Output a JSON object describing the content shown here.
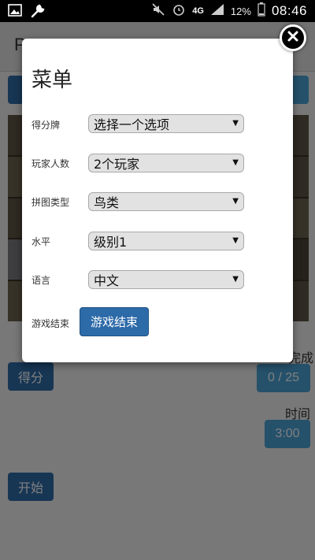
{
  "status_bar": {
    "network": "4G",
    "battery_percent": "12%",
    "time": "08:46"
  },
  "app": {
    "title": "P",
    "score_button": "得分",
    "completed_label": "完成",
    "progress": "0 / 25",
    "time_label": "时间",
    "timer": "3:00",
    "start_button": "开始"
  },
  "menu": {
    "title": "菜单",
    "rows": [
      {
        "label": "得分牌",
        "value": "选择一个选项"
      },
      {
        "label": "玩家人数",
        "value": "2个玩家"
      },
      {
        "label": "拼图类型",
        "value": "鸟类"
      },
      {
        "label": "水平",
        "value": "级别1"
      },
      {
        "label": "语言",
        "value": "中文"
      }
    ],
    "end_game_label": "游戏结束",
    "end_game_button": "游戏结束"
  },
  "icons": {
    "close": "close-icon",
    "image": "image-icon",
    "wrench": "wrench-icon",
    "mute": "mute-icon",
    "alarm": "alarm-icon",
    "signal": "signal-icon",
    "battery": "battery-icon"
  },
  "colors": {
    "primary_button": "#2d6aa8",
    "info_box": "#4aa3d6"
  }
}
